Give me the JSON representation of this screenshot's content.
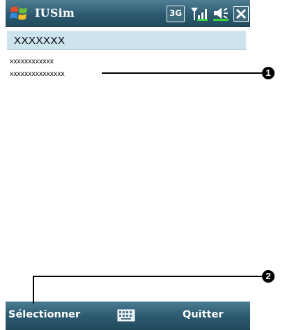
{
  "window": {
    "title": "IUSim",
    "network_badge": "3G",
    "start_icon": "windows-flag-icon",
    "signal_icon": "signal-icon",
    "volume_icon": "speaker-icon",
    "close_icon": "close-icon"
  },
  "sim_panel": {
    "header": "XXXXXXX",
    "items": [
      "xxxxxxxxxxxx",
      "xxxxxxxxxxxxxxx"
    ]
  },
  "menubar": {
    "left_label": "Sélectionner",
    "right_label": "Quitter",
    "keyboard_icon": "keyboard-icon"
  },
  "callouts": {
    "first": "1",
    "second": "2"
  },
  "colors": {
    "titlebar": "#2d5a70",
    "header_bg": "#cde4ee",
    "menubar": "#2c5a70"
  }
}
